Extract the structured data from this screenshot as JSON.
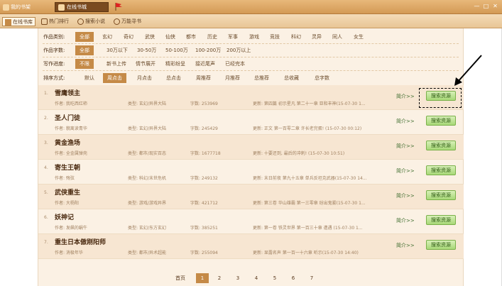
{
  "titlebar": {
    "my_shelf": "我的书架",
    "online_store": "在线书城"
  },
  "navbar": {
    "items": [
      "在线书库",
      "热门排行",
      "搜索小说",
      "万能寻书"
    ]
  },
  "filters": {
    "category": {
      "label": "作品类别:",
      "options": [
        "全部",
        "玄幻",
        "奇幻",
        "武侠",
        "仙侠",
        "都市",
        "历史",
        "军事",
        "游戏",
        "竞技",
        "科幻",
        "灵异",
        "同人",
        "女生"
      ],
      "selected": 0
    },
    "wordcount": {
      "label": "作品字数:",
      "options": [
        "全部",
        "30万以下",
        "30-50万",
        "50-100万",
        "100-200万",
        "200万以上"
      ],
      "selected": 0
    },
    "progress": {
      "label": "写作进度:",
      "options": [
        "不限",
        "新书上传",
        "情节展开",
        "精彩纷呈",
        "接近尾声",
        "已经完本"
      ],
      "selected": 0
    },
    "sort": {
      "label": "排序方式:",
      "options": [
        "默认",
        "周点击",
        "月点击",
        "总点击",
        "周推荐",
        "月推荐",
        "总推荐",
        "总收藏",
        "总字数"
      ],
      "selected": 1
    }
  },
  "list": {
    "brief_label": "简介>>",
    "search_label": "搜索资源",
    "rows": [
      {
        "num": "1.",
        "title": "雪鹰领主",
        "author": "作者: 我吃西红柿",
        "type": "类型: 玄幻/异界大陆",
        "words": "字数: 253969",
        "update": "更新: 第四篇  初示星凡  第二十一章 亚和丰神(15-07-30 1..."
      },
      {
        "num": "2.",
        "title": "圣人门徒",
        "author": "作者: 貌离读青华",
        "type": "类型: 玄幻/异界大陆",
        "words": "字数: 245429",
        "update": "更新: 正文  第一百零二章 许长老完蛋! (15-07-30 00:12)"
      },
      {
        "num": "3.",
        "title": "黄金渔场",
        "author": "作者: 全金属弹壳",
        "type": "类型: 都市/现实百态",
        "words": "字数: 1677718",
        "update": "更新: 十要还到, 最后的冲刺! (15-07-30 10:51)"
      },
      {
        "num": "4.",
        "title": "寄生王朝",
        "author": "作者: 殇弦",
        "type": "类型: 科幻/末世危机",
        "words": "字数: 249132",
        "update": "更新: 末日前夜  第九十五章 单兵反坦克武器(15-07-30 14..."
      },
      {
        "num": "5.",
        "title": "武侠重生",
        "author": "作者: 大杨阳",
        "type": "类型: 游戏/游戏异界",
        "words": "字数: 421712",
        "update": "更新: 第三卷  华山雄霸  第一三零章 纷出鬼雾(15-07-30 1..."
      },
      {
        "num": "6.",
        "title": "妖神记",
        "author": "作者: 发飙的蜗牛",
        "type": "类型: 玄幻/东方玄幻",
        "words": "字数: 385251",
        "update": "更新: 第一卷  铁灵世界  第一百三十章 遭遇 (15-07-30 1..."
      },
      {
        "num": "7.",
        "title": "重生日本傲刚阳师",
        "author": "作者: 消极年华",
        "type": "类型: 都市/异术超能",
        "words": "字数: 255094",
        "update": "更新: 显露名声  第一百一十六章 听示(15-07-30 14:40)"
      }
    ]
  },
  "pager": {
    "first": "首页",
    "pages": [
      "1",
      "2",
      "3",
      "4",
      "5",
      "6",
      "7"
    ],
    "current": 0
  }
}
